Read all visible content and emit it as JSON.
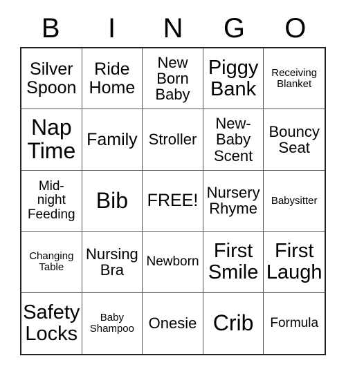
{
  "card": {
    "title": "BINGO",
    "header_letters": [
      "B",
      "I",
      "N",
      "G",
      "O"
    ],
    "rows": 5,
    "columns": 5,
    "free_space": "FREE!",
    "grid_border_color": "#222222",
    "cell_border_color": "#555555",
    "text_color": "#000000",
    "background_color": "#ffffff"
  },
  "cells": [
    {
      "text": "Silver\nSpoon",
      "size": "fs-lg"
    },
    {
      "text": "Ride\nHome",
      "size": "fs-lg"
    },
    {
      "text": "New\nBorn\nBaby",
      "size": "fs-md"
    },
    {
      "text": "Piggy\nBank",
      "size": "fs-xl"
    },
    {
      "text": "Receiving\nBlanket",
      "size": "fs-xs"
    },
    {
      "text": "Nap\nTime",
      "size": "fs-xxl"
    },
    {
      "text": "Family",
      "size": "fs-lg"
    },
    {
      "text": "Stroller",
      "size": "fs-md"
    },
    {
      "text": "New-\nBaby\nScent",
      "size": "fs-md"
    },
    {
      "text": "Bouncy\nSeat",
      "size": "fs-md"
    },
    {
      "text": "Mid-\nnight\nFeeding",
      "size": "fs-sm"
    },
    {
      "text": "Bib",
      "size": "fs-xxl"
    },
    {
      "text": "FREE!",
      "size": "fs-lg"
    },
    {
      "text": "Nursery\nRhyme",
      "size": "fs-md"
    },
    {
      "text": "Babysitter",
      "size": "fs-xs"
    },
    {
      "text": "Changing\nTable",
      "size": "fs-xs"
    },
    {
      "text": "Nursing\nBra",
      "size": "fs-md"
    },
    {
      "text": "Newborn",
      "size": "fs-sm"
    },
    {
      "text": "First\nSmile",
      "size": "fs-xl"
    },
    {
      "text": "First\nLaugh",
      "size": "fs-xl"
    },
    {
      "text": "Safety\nLocks",
      "size": "fs-xl"
    },
    {
      "text": "Baby\nShampoo",
      "size": "fs-xs"
    },
    {
      "text": "Onesie",
      "size": "fs-md"
    },
    {
      "text": "Crib",
      "size": "fs-xxl"
    },
    {
      "text": "Formula",
      "size": "fs-sm"
    }
  ]
}
